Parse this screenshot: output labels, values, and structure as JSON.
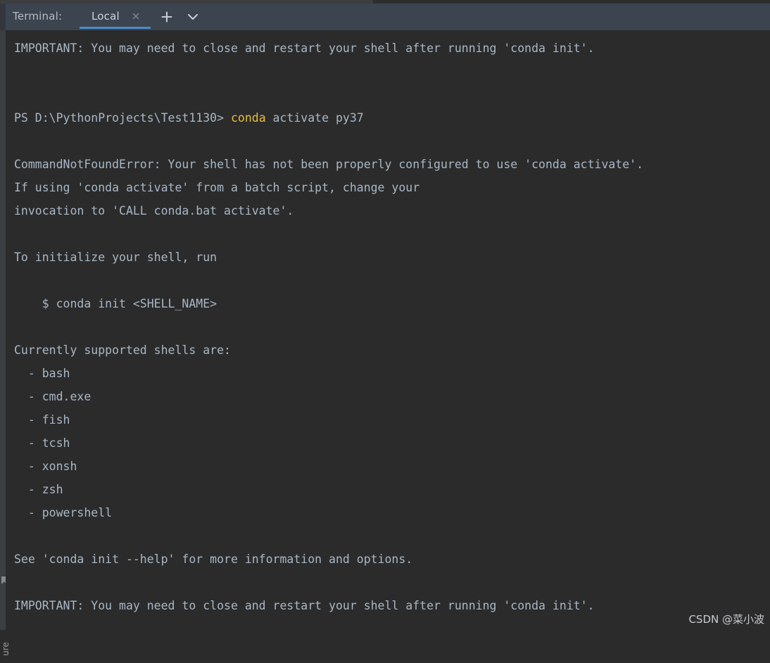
{
  "window": {
    "terminal_label": "Terminal:",
    "accent_color": "#4b8ccc",
    "tabbar_bg": "#3c4450",
    "terminal_bg": "#2b2b2b",
    "text_color": "#a9b7c6",
    "keyword_color": "#e8bf3c"
  },
  "tabs": [
    {
      "label": "Local",
      "active": true,
      "close_icon": "close-icon"
    }
  ],
  "toolbar": {
    "add_tab_icon": "plus-icon",
    "dropdown_icon": "chevron-down-icon"
  },
  "left_strip": {
    "bookmarks_label": "Bookmarks",
    "bookmarks_icon": "bookmark-icon",
    "bottom_label": "ure"
  },
  "terminal": {
    "lines": [
      {
        "segments": [
          {
            "text": "IMPORTANT: You may need to close and restart your shell after running 'conda init'.",
            "style": "default"
          }
        ]
      },
      {
        "segments": [
          {
            "text": "",
            "style": "default"
          }
        ]
      },
      {
        "segments": [
          {
            "text": "",
            "style": "default"
          }
        ]
      },
      {
        "segments": [
          {
            "text": "PS D:\\PythonProjects\\Test1130> ",
            "style": "default"
          },
          {
            "text": "conda",
            "style": "yellow"
          },
          {
            "text": " activate py37",
            "style": "default"
          }
        ]
      },
      {
        "segments": [
          {
            "text": "",
            "style": "default"
          }
        ]
      },
      {
        "segments": [
          {
            "text": "CommandNotFoundError: Your shell has not been properly configured to use 'conda activate'.",
            "style": "default"
          }
        ]
      },
      {
        "segments": [
          {
            "text": "If using 'conda activate' from a batch script, change your",
            "style": "default"
          }
        ]
      },
      {
        "segments": [
          {
            "text": "invocation to 'CALL conda.bat activate'.",
            "style": "default"
          }
        ]
      },
      {
        "segments": [
          {
            "text": "",
            "style": "default"
          }
        ]
      },
      {
        "segments": [
          {
            "text": "To initialize your shell, run",
            "style": "default"
          }
        ]
      },
      {
        "segments": [
          {
            "text": "",
            "style": "default"
          }
        ]
      },
      {
        "segments": [
          {
            "text": "    $ conda init <SHELL_NAME>",
            "style": "default"
          }
        ]
      },
      {
        "segments": [
          {
            "text": "",
            "style": "default"
          }
        ]
      },
      {
        "segments": [
          {
            "text": "Currently supported shells are:",
            "style": "default"
          }
        ]
      },
      {
        "segments": [
          {
            "text": "  - bash",
            "style": "default"
          }
        ]
      },
      {
        "segments": [
          {
            "text": "  - cmd.exe",
            "style": "default"
          }
        ]
      },
      {
        "segments": [
          {
            "text": "  - fish",
            "style": "default"
          }
        ]
      },
      {
        "segments": [
          {
            "text": "  - tcsh",
            "style": "default"
          }
        ]
      },
      {
        "segments": [
          {
            "text": "  - xonsh",
            "style": "default"
          }
        ]
      },
      {
        "segments": [
          {
            "text": "  - zsh",
            "style": "default"
          }
        ]
      },
      {
        "segments": [
          {
            "text": "  - powershell",
            "style": "default"
          }
        ]
      },
      {
        "segments": [
          {
            "text": "",
            "style": "default"
          }
        ]
      },
      {
        "segments": [
          {
            "text": "See 'conda init --help' for more information and options.",
            "style": "default"
          }
        ]
      },
      {
        "segments": [
          {
            "text": "",
            "style": "default"
          }
        ]
      },
      {
        "segments": [
          {
            "text": "IMPORTANT: You may need to close and restart your shell after running 'conda init'.",
            "style": "default"
          }
        ]
      }
    ]
  },
  "watermark": {
    "text": "CSDN @菜小波"
  }
}
